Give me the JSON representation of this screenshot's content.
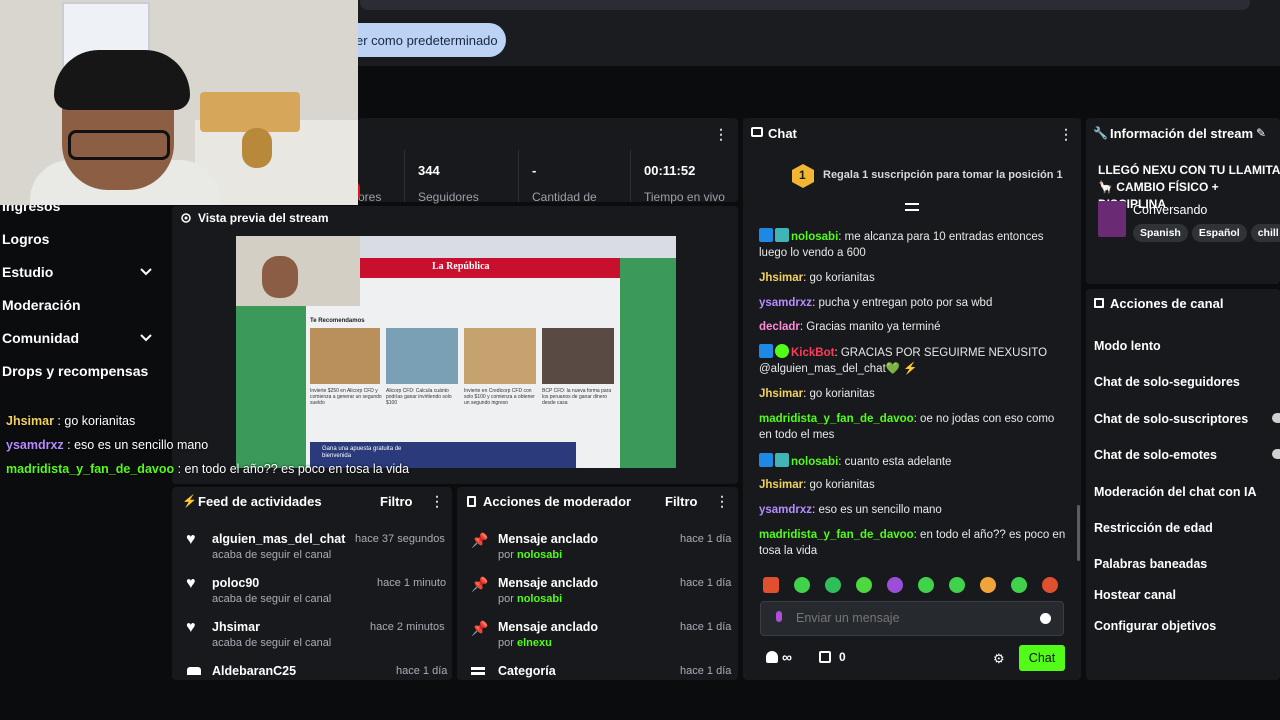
{
  "topbar": {
    "set_default_label": "er como predeterminado"
  },
  "sidebar": {
    "items": [
      {
        "label": "Ingresos"
      },
      {
        "label": "Logros"
      },
      {
        "label": "Estudio"
      },
      {
        "label": "Moderación"
      },
      {
        "label": "Comunidad"
      },
      {
        "label": "Drops y recompensas"
      }
    ]
  },
  "overlay_chat": [
    {
      "user": "Jhsimar",
      "text": " : go korianitas",
      "color": "#f4d15c"
    },
    {
      "user": "ysamdrxz",
      "text": " : eso es un sencillo mano",
      "color": "#b68cff"
    },
    {
      "user": "madridista_y_fan_de_davoo",
      "text": " : en todo el año?? es poco en tosa la vida",
      "color": "#53fc18"
    }
  ],
  "stats": [
    {
      "value": "",
      "label": "ores"
    },
    {
      "value": "344",
      "label": "Seguidores"
    },
    {
      "value": "-",
      "label": "Cantidad de"
    },
    {
      "value": "00:11:52",
      "label": "Tiempo en vivo"
    }
  ],
  "preview": {
    "title": "Vista previa del stream",
    "site_name": "La República",
    "section": "Te Recomendamos",
    "ad_text": "Gana una apuesta gratuita de bienvenida",
    "articles": [
      "Invierte $250 en Alicorp CFD y comienza a generar un segundo sueldo",
      "Alicorp CFD: Calcula cuánto podrías ganar invirtiendo solo $100",
      "Invierte en Credicorp CFD con solo $100 y comienza a obtener un segundo ingreso",
      "BCP CFD: la nueva forma para los peruanos de ganar dinero desde casa"
    ]
  },
  "feed": {
    "title": "Feed de actividades",
    "filter": "Filtro",
    "items": [
      {
        "name": "alguien_mas_del_chat",
        "sub": "acaba de seguir el canal",
        "time": "hace 37 segundos"
      },
      {
        "name": "poloc90",
        "sub": "acaba de seguir el canal",
        "time": "hace 1 minuto"
      },
      {
        "name": "Jhsimar",
        "sub": "acaba de seguir el canal",
        "time": "hace 2 minutos"
      },
      {
        "name": "AldebaranC25",
        "sub": "",
        "time": "hace 1 día"
      }
    ]
  },
  "mod_actions": {
    "title": "Acciones de moderador",
    "filter": "Filtro",
    "items": [
      {
        "name": "Mensaje anclado",
        "by": "por ",
        "user": "nolosabi",
        "time": "hace 1 día"
      },
      {
        "name": "Mensaje anclado",
        "by": "por ",
        "user": "nolosabi",
        "time": "hace 1 día"
      },
      {
        "name": "Mensaje anclado",
        "by": "por ",
        "user": "elnexu",
        "time": "hace 1 día"
      },
      {
        "name": "Categoría",
        "by": "",
        "user": "",
        "time": "hace 1 día"
      }
    ]
  },
  "chat": {
    "title": "Chat",
    "gift_rank": "1",
    "gift_text": "Regala 1 suscripción para tomar la posición 1",
    "messages": [
      {
        "user": "nolosabi",
        "text": ": me alcanza para 10 entradas entonces luego lo vendo a 600",
        "cls": "u-green",
        "badges": 2
      },
      {
        "user": "Jhsimar",
        "text": ": go korianitas",
        "cls": "u-yellow",
        "badges": 0
      },
      {
        "user": "ysamdrxz",
        "text": ": pucha y entregan poto por sa wbd",
        "cls": "u-purple",
        "badges": 0
      },
      {
        "user": "decladr",
        "text": ": Gracias manito ya terminé",
        "cls": "u-pink",
        "badges": 0
      },
      {
        "user": "KickBot",
        "text": ": GRACIAS POR SEGUIRME NEXUSITO @alguien_mas_del_chat💚 ⚡",
        "cls": "u-red",
        "badges": 2
      },
      {
        "user": "Jhsimar",
        "text": ": go korianitas",
        "cls": "u-yellow",
        "badges": 0
      },
      {
        "user": "madridista_y_fan_de_davoo",
        "text": ": oe no jodas con eso como en todo el mes",
        "cls": "u-green",
        "badges": 0
      },
      {
        "user": "nolosabi",
        "text": ": cuanto esta adelante",
        "cls": "u-green",
        "badges": 2
      },
      {
        "user": "Jhsimar",
        "text": ": go korianitas",
        "cls": "u-yellow",
        "badges": 0
      },
      {
        "user": "ysamdrxz",
        "text": ": eso es un sencillo mano",
        "cls": "u-purple",
        "badges": 0
      },
      {
        "user": "madridista_y_fan_de_davoo",
        "text": ": en todo el año?? es poco en tosa la vida",
        "cls": "u-green",
        "badges": 0
      }
    ],
    "input_placeholder": "Enviar un mensaje",
    "viewers": "∞",
    "cart_count": "0",
    "send_label": "Chat"
  },
  "stream_info": {
    "title": "Información del stream",
    "stream_title": "LLEGÓ NEXU CON TU LLAMITA 🦙 CAMBIO FÍSICO + DISCIPLINA",
    "category": "Conversando",
    "tags": [
      "Spanish",
      "Español",
      "chill"
    ]
  },
  "channel_actions": {
    "title": "Acciones de canal",
    "items": [
      {
        "label": "Modo lento"
      },
      {
        "label": "Chat de solo-seguidores"
      },
      {
        "label": "Chat de solo-suscriptores"
      },
      {
        "label": "Chat de solo-emotes"
      },
      {
        "label": "Moderación del chat con IA"
      },
      {
        "label": "Restricción de edad"
      },
      {
        "label": "Palabras baneadas"
      },
      {
        "label": "Hostear canal"
      },
      {
        "label": "Configurar objetivos"
      }
    ]
  },
  "colors": {
    "accent": "#53fc18",
    "panel": "#17191d",
    "background": "#0b0c0e"
  }
}
